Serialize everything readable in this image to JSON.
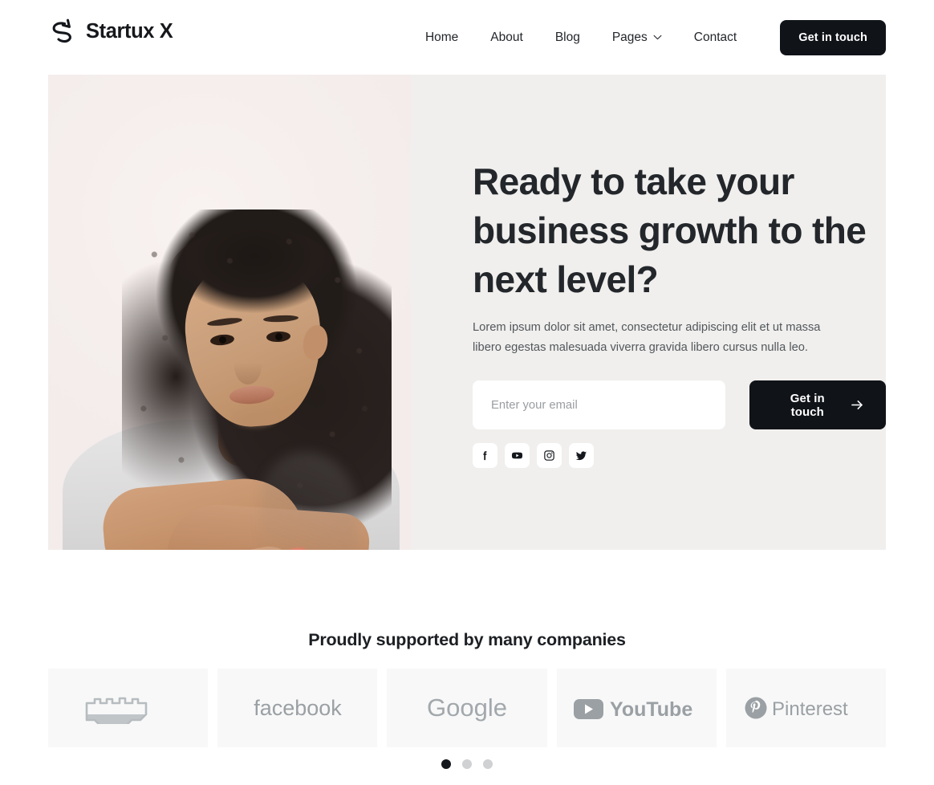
{
  "header": {
    "brand_name": "Startux X",
    "logo_icon": "arrow-swoosh-logo-icon",
    "nav": [
      {
        "label": "Home",
        "icon": null
      },
      {
        "label": "About",
        "icon": null
      },
      {
        "label": "Blog",
        "icon": null
      },
      {
        "label": "Pages",
        "icon": "chevron-down-icon"
      },
      {
        "label": "Contact",
        "icon": null
      }
    ],
    "cta_label": "Get in touch"
  },
  "hero": {
    "title": "Ready to take your business growth to the next level?",
    "subtitle": "Lorem ipsum dolor sit amet, consectetur adipiscing elit et ut massa libero egestas malesuada viverra gravida libero cursus nulla leo.",
    "email_placeholder": "Enter your email",
    "email_value": "",
    "cta_label": "Get in touch",
    "cta_icon": "arrow-right-icon",
    "image_alt": "portrait-of-smiling-woman-with-curly-hair-arms-crossed",
    "socials": [
      {
        "name": "facebook-icon",
        "label": "Facebook"
      },
      {
        "name": "youtube-icon",
        "label": "YouTube"
      },
      {
        "name": "instagram-icon",
        "label": "Instagram"
      },
      {
        "name": "twitter-icon",
        "label": "Twitter"
      }
    ]
  },
  "logos_section": {
    "title": "Proudly supported by many companies",
    "brands": [
      {
        "name": "twitch-logo",
        "label": "twitch"
      },
      {
        "name": "facebook-logo",
        "label": "facebook"
      },
      {
        "name": "google-logo",
        "label": "Google"
      },
      {
        "name": "youtube-logo",
        "label": "YouTube"
      },
      {
        "name": "pinterest-logo",
        "label": "Pinterest"
      }
    ],
    "carousel_dots": [
      {
        "active": true
      },
      {
        "active": false
      },
      {
        "active": false
      }
    ]
  },
  "colors": {
    "dark": "#101318",
    "hero_bg": "#f0efed",
    "hero_media_bg": "#f6efee",
    "card_bg": "#f8f8f8",
    "brand_grey": "#9aa0a4",
    "text": "#23272b",
    "muted": "#52575c"
  }
}
